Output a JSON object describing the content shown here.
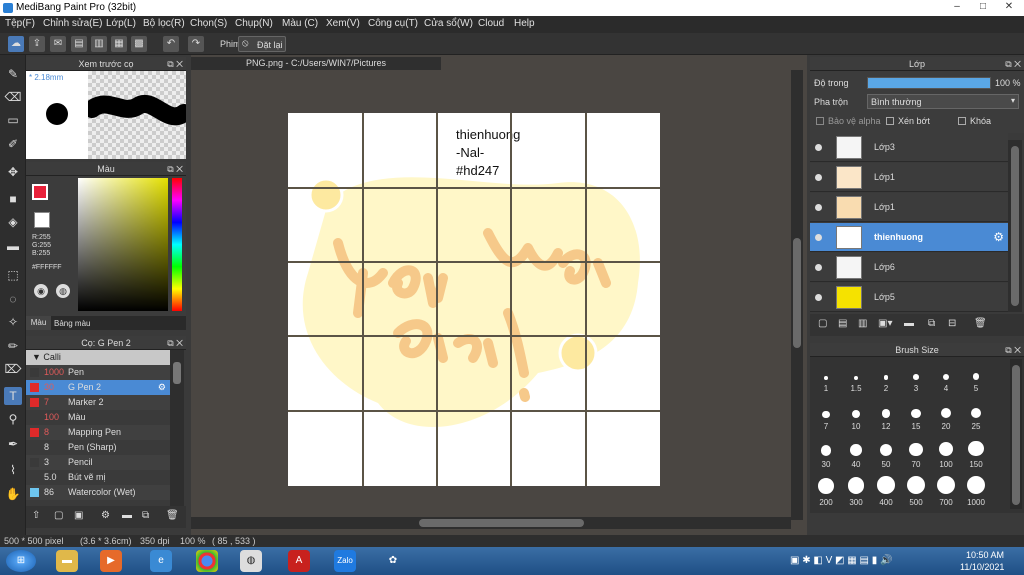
{
  "window": {
    "title": "MediBang Paint Pro (32bit)",
    "min": "–",
    "max": "□",
    "close": "✕"
  },
  "menu": [
    "Tệp(F)",
    "Chỉnh sửa(E)",
    "Lớp(L)",
    "Bộ lọc(R)",
    "Chọn(S)",
    "Chụp(N)",
    "Màu (C)",
    "Xem(V)",
    "Công cụ(T)",
    "Cửa sổ(W)",
    "Cloud",
    "Help"
  ],
  "toolbar": {
    "phim_label": "Phim",
    "reset_label": "Đặt lại"
  },
  "preview_panel": {
    "title": "Xem trước cọ",
    "size": "* 2.18mm"
  },
  "color_panel": {
    "title": "Màu",
    "r": "R:255",
    "g": "G:255",
    "b": "B:255",
    "hex": "#FFFFFF",
    "tab_color": "Màu",
    "tab_palette": "Bảng màu",
    "primary_color": "#e8213a"
  },
  "brush_panel": {
    "title": "Cọ: G Pen 2",
    "group": "Calli",
    "items": [
      {
        "size": "1000",
        "name": "Pen",
        "color": "#3a3a3a"
      },
      {
        "size": "30",
        "name": "G Pen 2",
        "color": "#e02a2a"
      },
      {
        "size": "7",
        "name": "Marker 2",
        "color": "#e02a2a"
      },
      {
        "size": "100",
        "name": "Màu",
        "color": "#3a3a3a"
      },
      {
        "size": "8",
        "name": "Mapping Pen",
        "color": "#e02a2a"
      },
      {
        "size": "8",
        "name": "Pen (Sharp)",
        "color": "#3a3a3a"
      },
      {
        "size": "3",
        "name": "Pencil",
        "color": "#3a3a3a"
      },
      {
        "size": "5.0",
        "name": "Bút vẽ mị",
        "color": "#3a3a3a"
      },
      {
        "size": "86",
        "name": "Watercolor (Wet)",
        "color": "#6ec6f0"
      }
    ]
  },
  "document": {
    "tab": "PNG.png - C:/Users/WIN7/Pictures",
    "text_line1": "thienhuong",
    "text_line2": "-Nal-",
    "text_line3": "#hd247",
    "lettering": "Yêu hơn qué!"
  },
  "layer_panel": {
    "title": "Lớp",
    "opacity_label": "Độ trong",
    "opacity_value": "100 %",
    "opacity_level": 1.0,
    "blend_label": "Pha trộn",
    "blend_value": "Bình thường",
    "opt_alpha": "Bảo vệ alpha",
    "opt_clip": "Xén bớt",
    "opt_lock": "Khóa",
    "layers": [
      {
        "name": "Lớp3",
        "selected": false
      },
      {
        "name": "Lớp1",
        "selected": false
      },
      {
        "name": "Lớp1",
        "selected": false
      },
      {
        "name": "thienhuong",
        "selected": true
      },
      {
        "name": "Lớp6",
        "selected": false
      },
      {
        "name": "Lớp5",
        "selected": false
      }
    ]
  },
  "brush_size_panel": {
    "title": "Brush Size",
    "sizes": [
      "1",
      "1.5",
      "2",
      "3",
      "4",
      "5",
      "7",
      "10",
      "12",
      "15",
      "20",
      "25",
      "30",
      "40",
      "50",
      "70",
      "100",
      "150",
      "200",
      "300",
      "400",
      "500",
      "700",
      "1000"
    ]
  },
  "status": {
    "dims": "500 * 500 pixel",
    "cm": "(3.6 * 3.6cm)",
    "dpi": "350 dpi",
    "zoom": "100 %",
    "coords": "( 85 , 533 )"
  },
  "taskbar": {
    "time": "10:50 AM",
    "date": "11/10/2021",
    "zalo": "Zalo"
  }
}
